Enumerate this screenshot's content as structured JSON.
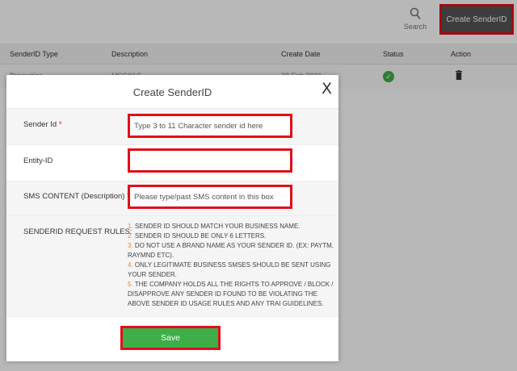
{
  "toolbar": {
    "search_label": "Search",
    "create_button_label": "Create SenderID"
  },
  "table": {
    "columns": [
      "SenderID Type",
      "Description",
      "Create Date",
      "Status",
      "Action"
    ],
    "rows": [
      {
        "type": "Promotion",
        "description": "MSG91C",
        "date": "28 Feb 2021",
        "status": "active",
        "action": "delete"
      }
    ]
  },
  "modal": {
    "title": "Create SenderID",
    "close_symbol": "X",
    "sender_id": {
      "label": "Sender Id",
      "placeholder": "Type 3 to 11 Character sender id here",
      "value": ""
    },
    "entity_id": {
      "label": "Entity-ID",
      "placeholder": "",
      "value": ""
    },
    "sms_content": {
      "label": "SMS CONTENT (Description)",
      "placeholder": "Please type/past SMS content in this box",
      "value": ""
    },
    "required_mark": "*",
    "rules_label": "SENDERID REQUEST RULES:",
    "rules": [
      {
        "num": "1.",
        "text": "SENDER ID SHOULD MATCH YOUR BUSINESS NAME."
      },
      {
        "num": "2.",
        "text": "SENDER ID SHOULD BE ONLY 6 LETTERS."
      },
      {
        "num": "3.",
        "text": "DO NOT USE A BRAND NAME AS YOUR SENDER ID. (EX: PAYTM, RAYMND ETC)."
      },
      {
        "num": "4.",
        "text": "ONLY LEGITIMATE BUSINESS SMSES SHOULD BE SENT USING YOUR SENDER."
      },
      {
        "num": "5.",
        "text": "THE COMPANY HOLDS ALL THE RIGHTS TO APPROVE / BLOCK / DISAPPROVE ANY SENDER ID FOUND TO BE VIOLATING THE ABOVE SENDER ID USAGE RULES AND ANY TRAI GUIDELINES."
      }
    ],
    "save_label": "Save"
  },
  "colors": {
    "highlight": "#e0101a",
    "save_green": "#3fae49",
    "rule_number": "#e08a2c",
    "create_button_bg": "#555555"
  },
  "icons": {
    "search": "magnifier-icon",
    "status": "check-circle-icon",
    "action": "trash-icon",
    "close": "close-icon"
  }
}
